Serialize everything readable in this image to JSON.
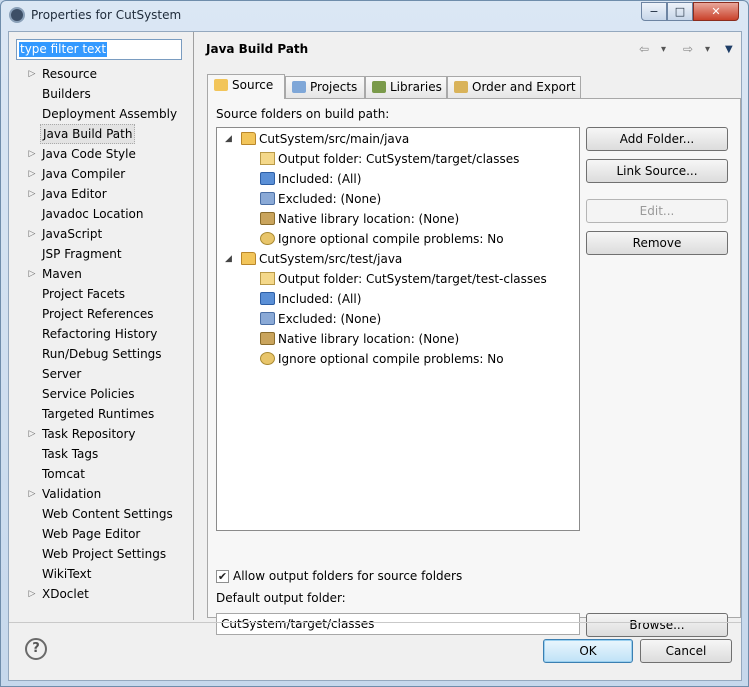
{
  "window": {
    "title": "Properties for CutSystem",
    "controls": {
      "minimize": "−",
      "maximize": "□",
      "close": "✕"
    }
  },
  "filter": {
    "value": "type filter text"
  },
  "nav": {
    "selected": "Java Build Path",
    "items": [
      {
        "label": "Resource",
        "expandable": true
      },
      {
        "label": "Builders",
        "expandable": false
      },
      {
        "label": "Deployment Assembly",
        "expandable": false
      },
      {
        "label": "Java Build Path",
        "expandable": false
      },
      {
        "label": "Java Code Style",
        "expandable": true
      },
      {
        "label": "Java Compiler",
        "expandable": true
      },
      {
        "label": "Java Editor",
        "expandable": true
      },
      {
        "label": "Javadoc Location",
        "expandable": false
      },
      {
        "label": "JavaScript",
        "expandable": true
      },
      {
        "label": "JSP Fragment",
        "expandable": false
      },
      {
        "label": "Maven",
        "expandable": true
      },
      {
        "label": "Project Facets",
        "expandable": false
      },
      {
        "label": "Project References",
        "expandable": false
      },
      {
        "label": "Refactoring History",
        "expandable": false
      },
      {
        "label": "Run/Debug Settings",
        "expandable": false
      },
      {
        "label": "Server",
        "expandable": false
      },
      {
        "label": "Service Policies",
        "expandable": false
      },
      {
        "label": "Targeted Runtimes",
        "expandable": false
      },
      {
        "label": "Task Repository",
        "expandable": true
      },
      {
        "label": "Task Tags",
        "expandable": false
      },
      {
        "label": "Tomcat",
        "expandable": false
      },
      {
        "label": "Validation",
        "expandable": true
      },
      {
        "label": "Web Content Settings",
        "expandable": false
      },
      {
        "label": "Web Page Editor",
        "expandable": false
      },
      {
        "label": "Web Project Settings",
        "expandable": false
      },
      {
        "label": "WikiText",
        "expandable": false
      },
      {
        "label": "XDoclet",
        "expandable": true
      }
    ]
  },
  "page": {
    "title": "Java Build Path",
    "nav_arrows": {
      "back": "⇦",
      "back_menu": "▾",
      "forward": "⇨",
      "forward_menu": "▾",
      "view_menu": "▼"
    }
  },
  "tabs": [
    {
      "label": "Source",
      "active": true,
      "icon": "source-folder-icon",
      "color": "#f2c55a"
    },
    {
      "label": "Projects",
      "active": false,
      "icon": "projects-icon",
      "color": "#7fa7d8"
    },
    {
      "label": "Libraries",
      "active": false,
      "icon": "libraries-icon",
      "color": "#7a9a4a"
    },
    {
      "label": "Order and Export",
      "active": false,
      "icon": "order-export-icon",
      "color": "#d9b35a"
    }
  ],
  "source": {
    "label": "Source folders on build path:",
    "folders": [
      {
        "name": "CutSystem/src/main/java",
        "children": [
          {
            "icon": "out",
            "text": "Output folder: CutSystem/target/classes"
          },
          {
            "icon": "inc",
            "text": "Included: (All)"
          },
          {
            "icon": "exc",
            "text": "Excluded: (None)"
          },
          {
            "icon": "lib",
            "text": "Native library location: (None)"
          },
          {
            "icon": "ign",
            "text": "Ignore optional compile problems: No"
          }
        ]
      },
      {
        "name": "CutSystem/src/test/java",
        "children": [
          {
            "icon": "out",
            "text": "Output folder: CutSystem/target/test-classes"
          },
          {
            "icon": "inc",
            "text": "Included: (All)"
          },
          {
            "icon": "exc",
            "text": "Excluded: (None)"
          },
          {
            "icon": "lib",
            "text": "Native library location: (None)"
          },
          {
            "icon": "ign",
            "text": "Ignore optional compile problems: No"
          }
        ]
      }
    ],
    "buttons": {
      "add_folder": "Add Folder...",
      "link_source": "Link Source...",
      "edit": "Edit...",
      "remove": "Remove"
    },
    "allow_output": {
      "label": "Allow output folders for source folders",
      "checked": true,
      "mark": "✔"
    },
    "default_output": {
      "label": "Default output folder:",
      "value": "CutSystem/target/classes"
    },
    "browse": "Browse..."
  },
  "dialog": {
    "help": "?",
    "ok": "OK",
    "cancel": "Cancel"
  },
  "glyphs": {
    "collapsed": "▷",
    "expanded": "◢"
  }
}
